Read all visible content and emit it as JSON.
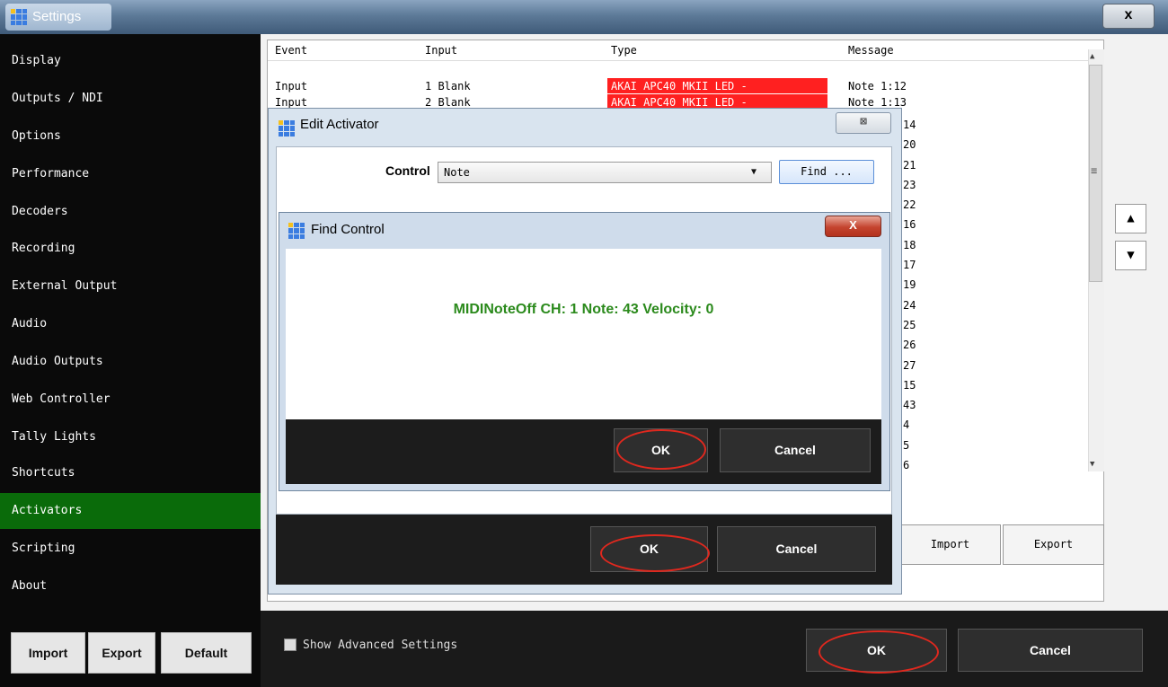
{
  "window": {
    "title": "Settings",
    "close_glyph": "x"
  },
  "sidebar": {
    "items": [
      {
        "label": "Display"
      },
      {
        "label": "Outputs / NDI"
      },
      {
        "label": "Options"
      },
      {
        "label": "Performance"
      },
      {
        "label": "Decoders"
      },
      {
        "label": "Recording"
      },
      {
        "label": "External Output"
      },
      {
        "label": "Audio"
      },
      {
        "label": "Audio Outputs"
      },
      {
        "label": "Web Controller"
      },
      {
        "label": "Tally Lights"
      },
      {
        "label": "Shortcuts"
      },
      {
        "label": "Activators"
      },
      {
        "label": "Scripting"
      },
      {
        "label": "About"
      }
    ],
    "active_item": "Activators",
    "buttons": {
      "import": "Import",
      "export": "Export",
      "default": "Default"
    }
  },
  "activators_table": {
    "columns": [
      "Event",
      "Input",
      "Type",
      "Message"
    ],
    "rows": [
      {
        "event": "Input",
        "input": "1 Blank",
        "type": "AKAI APC40 MKII LED -",
        "message": "Note 1:12"
      },
      {
        "event": "Input",
        "input": "2 Blank",
        "type": "AKAI APC40 MKII LED -",
        "message": "Note 1:13"
      }
    ],
    "visible_message_fragments": [
      "14",
      "20",
      "21",
      "23",
      "22",
      "16",
      "18",
      "17",
      "19",
      "24",
      "25",
      "26",
      "27",
      "15",
      "43",
      "4",
      "5",
      "6"
    ],
    "scroll_glyph_up": "▲",
    "scroll_glyph_down": "▼",
    "scroll_glyph_grip": "≡"
  },
  "row_controls": {
    "move_up": "▲",
    "move_down": "▼"
  },
  "main_buttons": {
    "import": "Import",
    "export": "Export"
  },
  "bottom_bar": {
    "show_advanced_label": "Show Advanced Settings",
    "show_advanced_checked": false,
    "ok": "OK",
    "cancel": "Cancel"
  },
  "edit_activator": {
    "title": "Edit Activator",
    "close_glyph": "⊠",
    "control_label": "Control",
    "control_value": "Note",
    "find_button": "Find ...",
    "ok": "OK",
    "cancel": "Cancel"
  },
  "find_control": {
    "title": "Find Control",
    "close_glyph": "X",
    "message": "MIDINoteOff CH: 1 Note: 43 Velocity: 0",
    "ok": "OK",
    "cancel": "Cancel"
  },
  "colors": {
    "active_sidebar": "#0a6b0a",
    "type_cell": "#ff2020",
    "find_message": "#2b8a1c",
    "annotation_ring": "#e0281e"
  },
  "icons": {
    "app": "app-grid-icon",
    "dropdown": "chevron-down-icon"
  }
}
